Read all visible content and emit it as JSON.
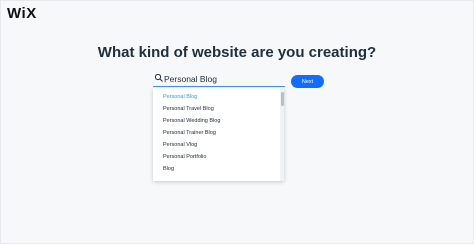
{
  "brand": {
    "logo_text": "WiX"
  },
  "headline": "What kind of website are you creating?",
  "search": {
    "value": "Personal Blog",
    "placeholder": ""
  },
  "next_button": {
    "label": "Next"
  },
  "suggestions": [
    {
      "label": "Personal Blog",
      "highlighted": true
    },
    {
      "label": "Personal Travel Blog",
      "highlighted": false
    },
    {
      "label": "Personal Wedding Blog",
      "highlighted": false
    },
    {
      "label": "Personal Trainer Blog",
      "highlighted": false
    },
    {
      "label": "Personal Vlog",
      "highlighted": false
    },
    {
      "label": "Personal Portfolio",
      "highlighted": false
    },
    {
      "label": "Blog",
      "highlighted": false
    }
  ],
  "colors": {
    "accent": "#116dff",
    "link": "#3899ec",
    "text": "#20303c"
  }
}
